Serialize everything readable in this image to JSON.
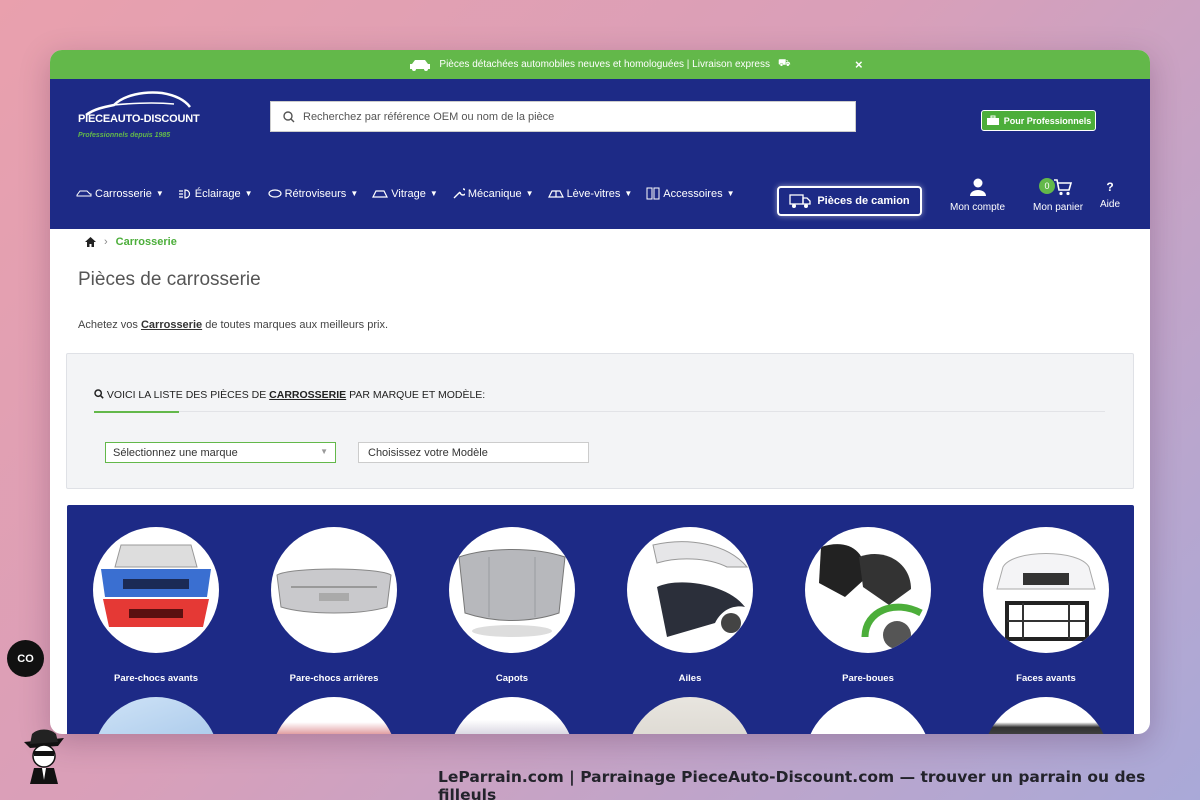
{
  "topbar": {
    "text": "Pièces détachées automobiles neuves et homologuées | Livraison express",
    "close": "×"
  },
  "logo": {
    "brand": "PIECEAUTO-DISCOUNT",
    "tagline": "Professionnels depuis 1985"
  },
  "search": {
    "placeholder": "Recherchez par référence OEM ou nom de la pièce"
  },
  "pro_button": "Pour Professionnels",
  "nav": [
    {
      "label": "Carrosserie",
      "icon": "car-icon"
    },
    {
      "label": "Éclairage",
      "icon": "headlight-icon"
    },
    {
      "label": "Rétroviseurs",
      "icon": "mirror-icon"
    },
    {
      "label": "Vitrage",
      "icon": "windshield-icon"
    },
    {
      "label": "Mécanique",
      "icon": "wrench-icon"
    },
    {
      "label": "Lève-vitres",
      "icon": "window-icon"
    },
    {
      "label": "Accessoires",
      "icon": "accessories-icon"
    }
  ],
  "truck_button": "Pièces de camion",
  "account": {
    "label": "Mon compte"
  },
  "cart": {
    "label": "Mon panier",
    "count": "0"
  },
  "help": {
    "label": "Aide",
    "symbol": "?"
  },
  "breadcrumb": {
    "current": "Carrosserie"
  },
  "page_title": "Pièces de carrosserie",
  "intro": {
    "before": "Achetez vos ",
    "link": "Carrosserie",
    "after": " de toutes marques aux meilleurs prix."
  },
  "filter": {
    "heading_before": "VOICI LA LISTE DES PIÈCES DE ",
    "heading_bold": "CARROSSERIE",
    "heading_after": " PAR MARQUE ET MODÈLE:",
    "brand_select": "Sélectionnez une marque",
    "model_select": "Choisissez votre Modèle"
  },
  "categories": [
    {
      "name": "Pare-chocs avants"
    },
    {
      "name": "Pare-chocs arrières"
    },
    {
      "name": "Capots"
    },
    {
      "name": "Ailes"
    },
    {
      "name": "Pare-boues"
    },
    {
      "name": "Faces avants"
    }
  ],
  "chat_button": "CO",
  "footer": "LeParrain.com | Parrainage PieceAuto-Discount.com — trouver un parrain ou des filleuls",
  "colors": {
    "green": "#63b84a",
    "navy": "#1d2a86"
  }
}
